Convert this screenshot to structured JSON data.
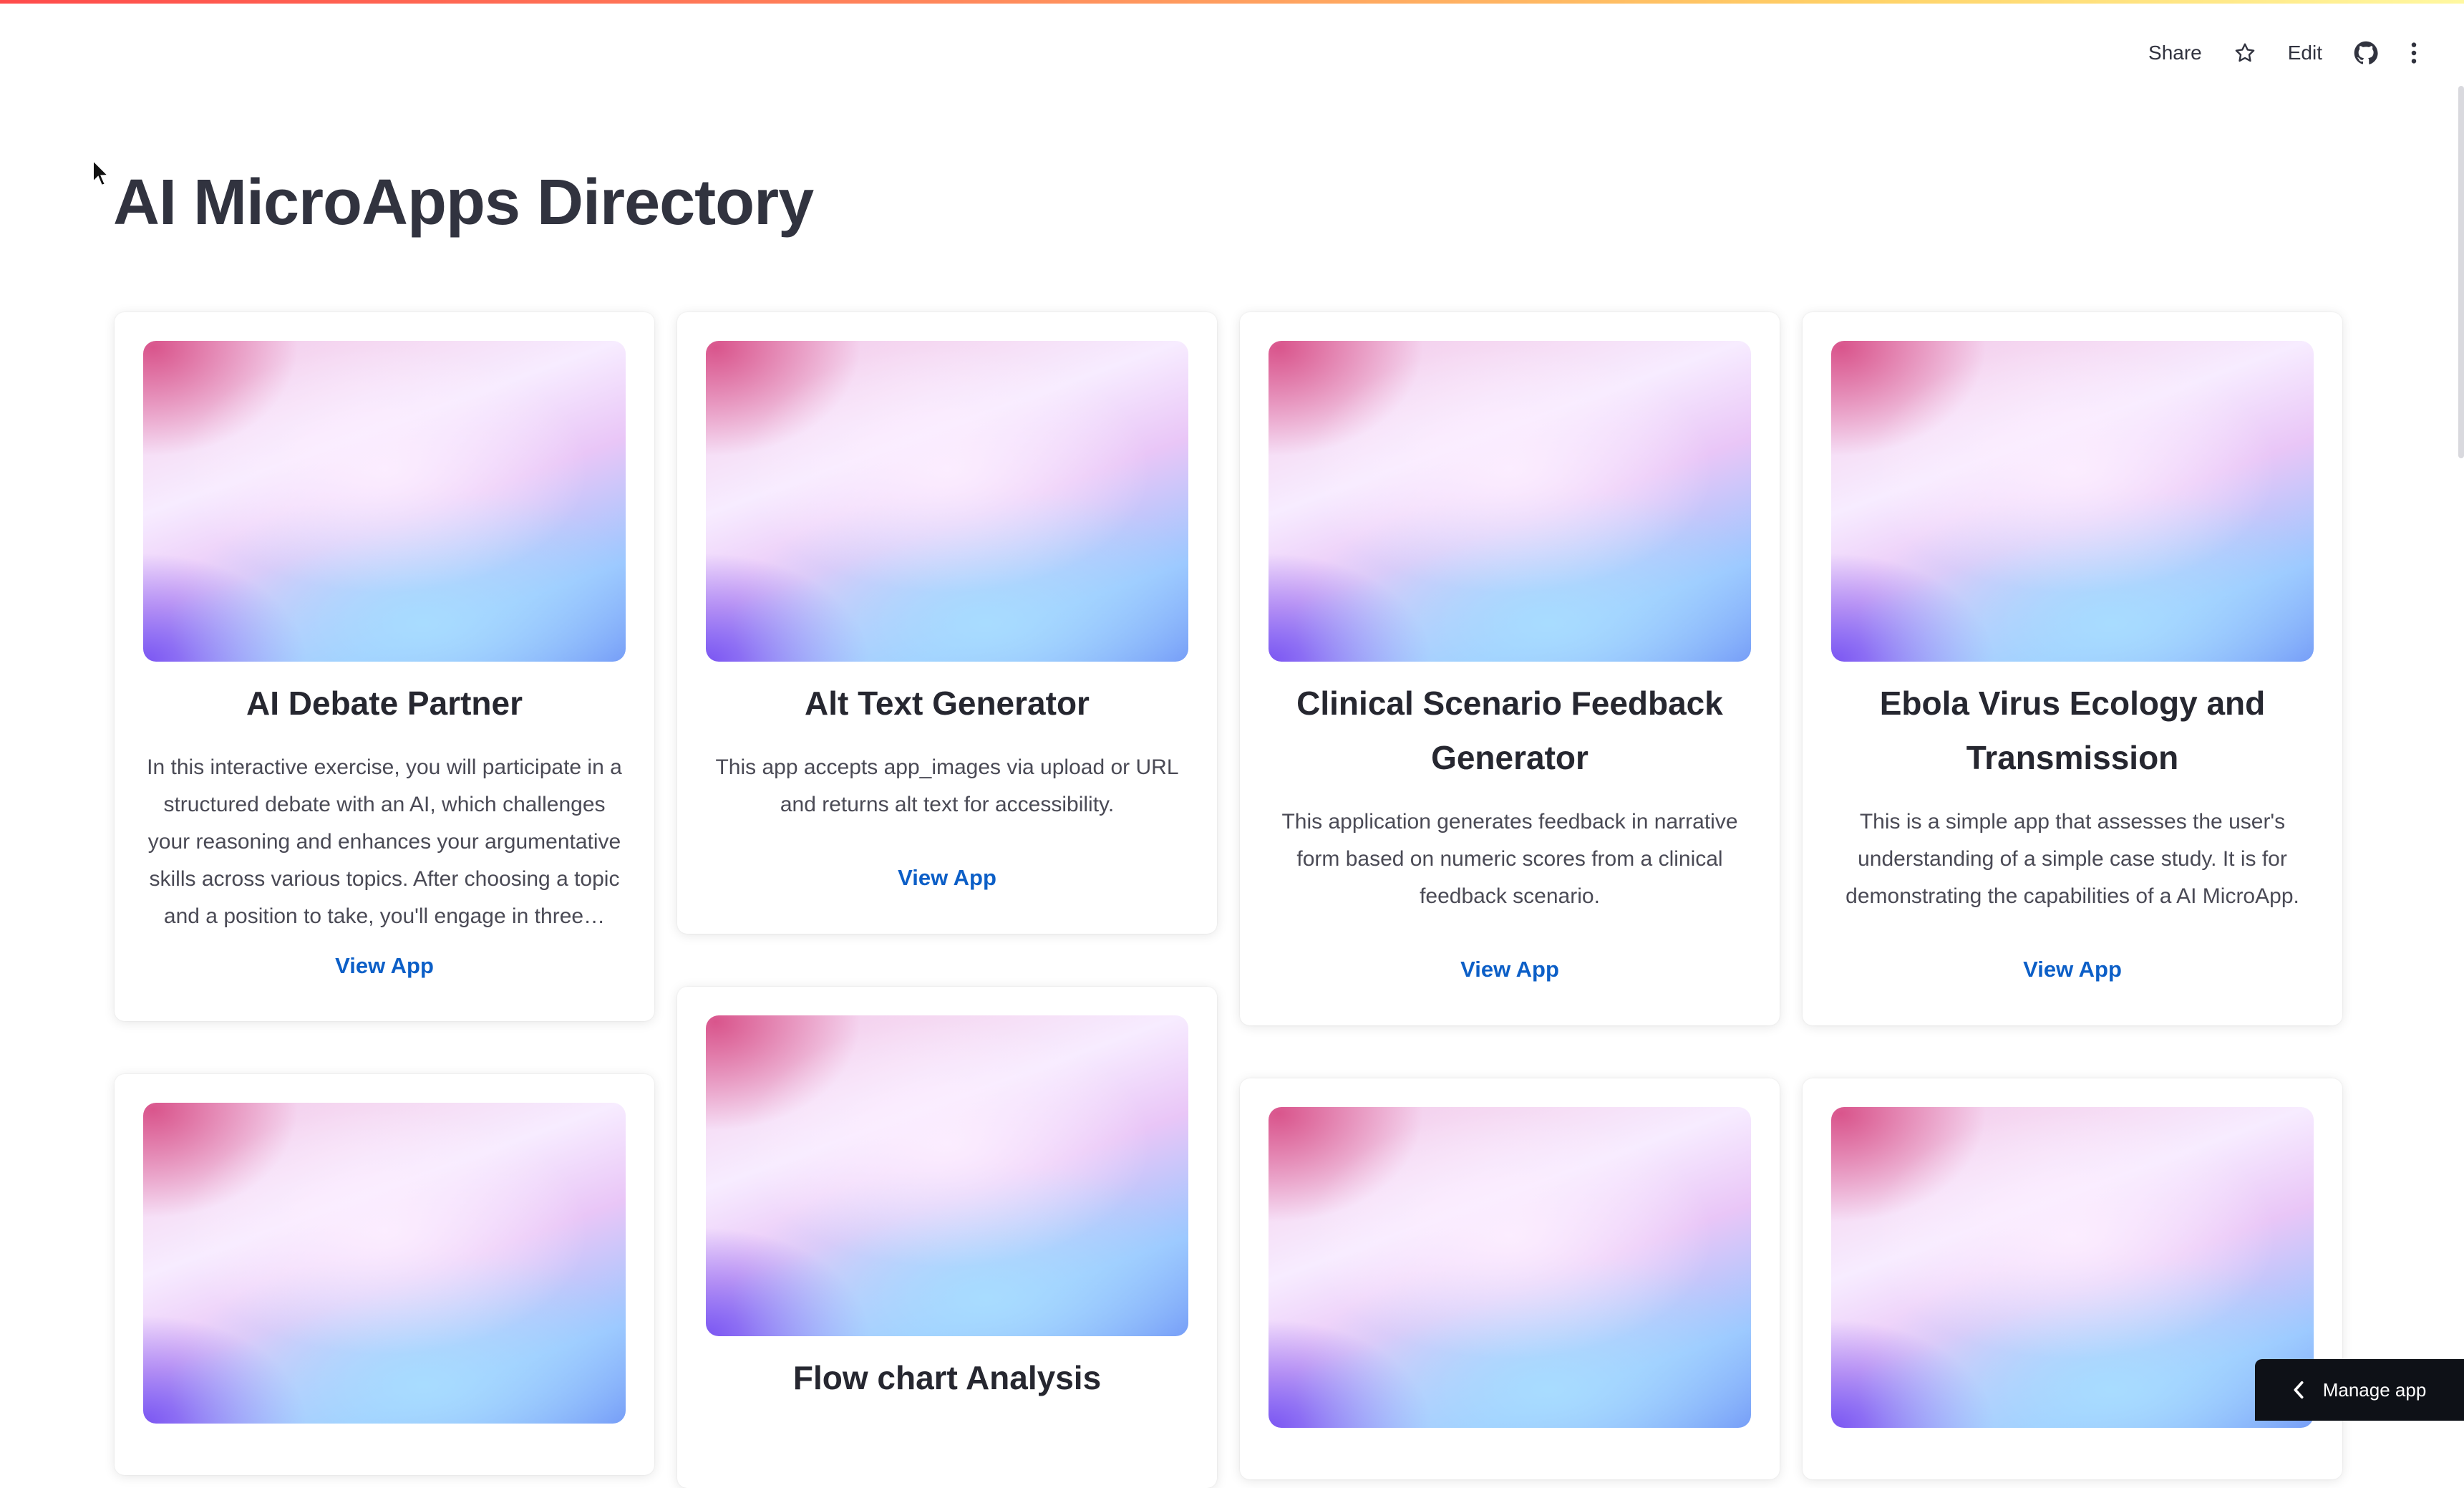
{
  "toolbar": {
    "share_label": "Share",
    "edit_label": "Edit"
  },
  "page": {
    "title": "AI MicroApps Directory"
  },
  "cards": [
    {
      "title": "AI Debate Partner",
      "description": "In this interactive exercise, you will participate in a structured debate with an AI, which challenges your reasoning and enhances your argumentative skills across various topics. After choosing a topic and a position to take, you'll engage in three…",
      "link": "View App"
    },
    {
      "title": "Alt Text Generator",
      "description": "This app accepts app_images via upload or URL and returns alt text for accessibility.",
      "link": "View App"
    },
    {
      "title": "Clinical Scenario Feedback Generator",
      "description": "This application generates feedback in narrative form based on numeric scores from a clinical feedback scenario.",
      "link": "View App"
    },
    {
      "title": "Ebola Virus Ecology and Transmission",
      "description": "This is a simple app that assesses the user's understanding of a simple case study. It is for demonstrating the capabilities of a AI MicroApp.",
      "link": "View App"
    },
    {
      "title": ""
    },
    {
      "title": "Flow chart Analysis"
    },
    {
      "title": ""
    },
    {
      "title": ""
    }
  ],
  "manage_app": {
    "label": "Manage app"
  }
}
